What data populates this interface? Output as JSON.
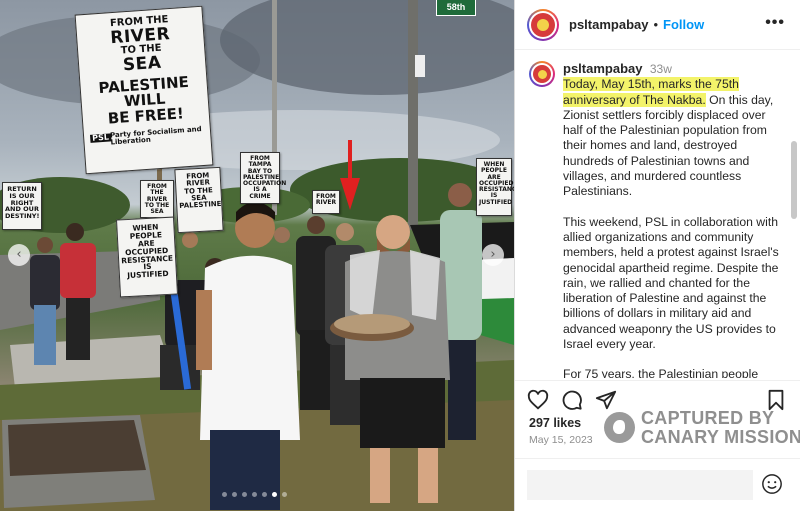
{
  "post": {
    "username": "psltampabay",
    "follow_label": "Follow",
    "more_icon": "more-horizontal-icon",
    "caption": {
      "username": "psltampabay",
      "timestamp": "33w",
      "highlighted": "Today, May 15th, marks the 75th anniversary of The Nakba.",
      "para1_rest": " On this day, Zionist settlers forcibly displaced over half of the Palestinian population from their homes and land, destroyed hundreds of Palestinian towns and villages, and murdered countless Palestinians.",
      "para2": "This weekend, PSL in collaboration with allied organizations and community members, held a protest against Israel's genocidal apartheid regime. Despite the rain, we rallied and chanted for the liberation of Palestine and against the billions of dollars in military aid and advanced weaponry the US provides to Israel every year.",
      "para3": "For 75 years, the Palestinian people"
    },
    "likes": "297 likes",
    "date": "May 15, 2023",
    "icons": {
      "like": "heart-icon",
      "comment": "comment-icon",
      "share": "send-icon",
      "save": "bookmark-icon",
      "emoji": "emoji-icon"
    },
    "carousel": {
      "total": 7,
      "active_index": 5
    }
  },
  "photo": {
    "main_sign": [
      "FROM THE",
      "RIVER",
      "TO THE",
      "SEA",
      "PALESTINE",
      "WILL",
      "BE FREE!"
    ],
    "main_sign_footer": "Party for Socialism and Liberation",
    "sign_return": [
      "RETURN",
      "IS OUR",
      "RIGHT",
      "AND OUR",
      "DESTINY!"
    ],
    "sign_river": [
      "FROM THE",
      "RIVER",
      "TO THE",
      "SEA"
    ],
    "sign_river2": [
      "FROM",
      "RIVER",
      "TO THE",
      "SEA",
      "PALESTINE"
    ],
    "sign_tampa": [
      "FROM",
      "TAMPA",
      "BAY TO",
      "PALESTINE",
      "OCCUPATION",
      "IS A",
      "CRIME"
    ],
    "sign_when_left": [
      "WHEN",
      "PEOPLE",
      "ARE",
      "OCCUPIED",
      "RESISTANCE",
      "IS",
      "JUSTIFIED"
    ],
    "sign_when_right": [
      "WHEN",
      "PEOPLE",
      "ARE",
      "OCCUPIED",
      "RESISTANCE",
      "IS",
      "JUSTIFIED"
    ],
    "sign_mid": [
      "FROM",
      "RIVER"
    ],
    "street_sign": "58th"
  },
  "watermark": {
    "line1": "CAPTURED BY",
    "line2": "CANARY MISSION"
  },
  "colors": {
    "follow": "#0095f6",
    "highlight": "#f3f36a",
    "watermark": "#8f8f8f"
  }
}
